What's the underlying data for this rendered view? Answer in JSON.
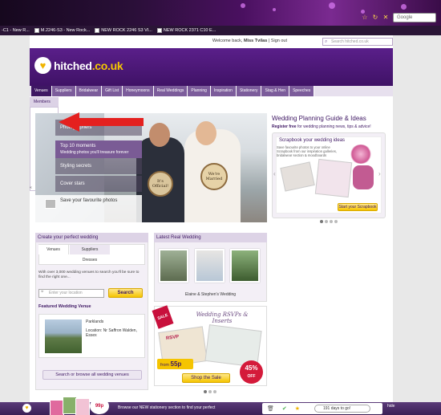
{
  "browser": {
    "search_engine": "Google",
    "bookmarks": [
      "-C1 - New R...",
      "M.2246-S3 - New Rock...",
      "NEW ROCK 2246 S3 VI...",
      "NEW ROCK 2371 C10 E..."
    ]
  },
  "utility": {
    "welcome_prefix": "Welcome back,",
    "welcome_name": "Miss Tvilas",
    "sign_out": "Sign out",
    "search_placeholder": "Search hitched.co.uk"
  },
  "logo": {
    "name": "hitched",
    "tld": ".co.uk"
  },
  "nav": {
    "items": [
      "Venues",
      "Suppliers",
      "Bridalwear",
      "Gift List",
      "Honeymoons",
      "Real Weddings",
      "Planning",
      "Inspiration",
      "Stationery",
      "Stag & Hen",
      "Speeches"
    ],
    "sub_item": "Members"
  },
  "hero": {
    "links": [
      {
        "title": "Photographers",
        "subtitle": ""
      },
      {
        "title": "Top 10 moments",
        "subtitle": "Wedding photos you'll treasure forever"
      },
      {
        "title": "Styling secrets",
        "subtitle": ""
      },
      {
        "title": "Cover stars",
        "subtitle": ""
      }
    ],
    "photos_cta": "Save your favourite photos",
    "sign_left": "It's Official!",
    "sign_right": "We're Married"
  },
  "guide": {
    "title": "Wedding Planning Guide & Ideas",
    "sub_bold": "Register free",
    "sub_rest": "for wedding planning news, tips & advice!",
    "scrap_title": "Scrapbook your wedding ideas",
    "scrap_desc": "Save favourite photos to your online Scrapbook from our inspiration galleries, bridalwear section & moodboards",
    "scrap_button": "Start your Scrapbook"
  },
  "venues": {
    "header": "Create your perfect wedding",
    "tabs": [
      "Venues",
      "Suppliers",
      "Dresses"
    ],
    "description": "With over 3,000 wedding venues to search you'll be sure to find the right one...",
    "input_placeholder": "Enter your location",
    "search_button": "Search",
    "featured_title": "Featured Wedding Venue",
    "featured_name": "Parklands",
    "featured_location": "Location: Nr Saffron Walden, Essex",
    "all_button": "Search or browse all wedding venues"
  },
  "latest": {
    "header": "Latest Real Wedding",
    "caption": "Elaine & Stephen's Wedding"
  },
  "rsvp": {
    "sale_tag": "SALE",
    "title": "Wedding RSVPs & Inserts",
    "card_text": "RSVP",
    "from_label": "from",
    "from_price": "55p",
    "badge_value": "45%",
    "badge_off": "OFF",
    "shop_button": "Shop the Sale"
  },
  "bottombar": {
    "price_tag": "99p",
    "message": "Browse our NEW stationery section to find your perfect",
    "days_to_go": "191 days to go!",
    "hide": "hide"
  }
}
